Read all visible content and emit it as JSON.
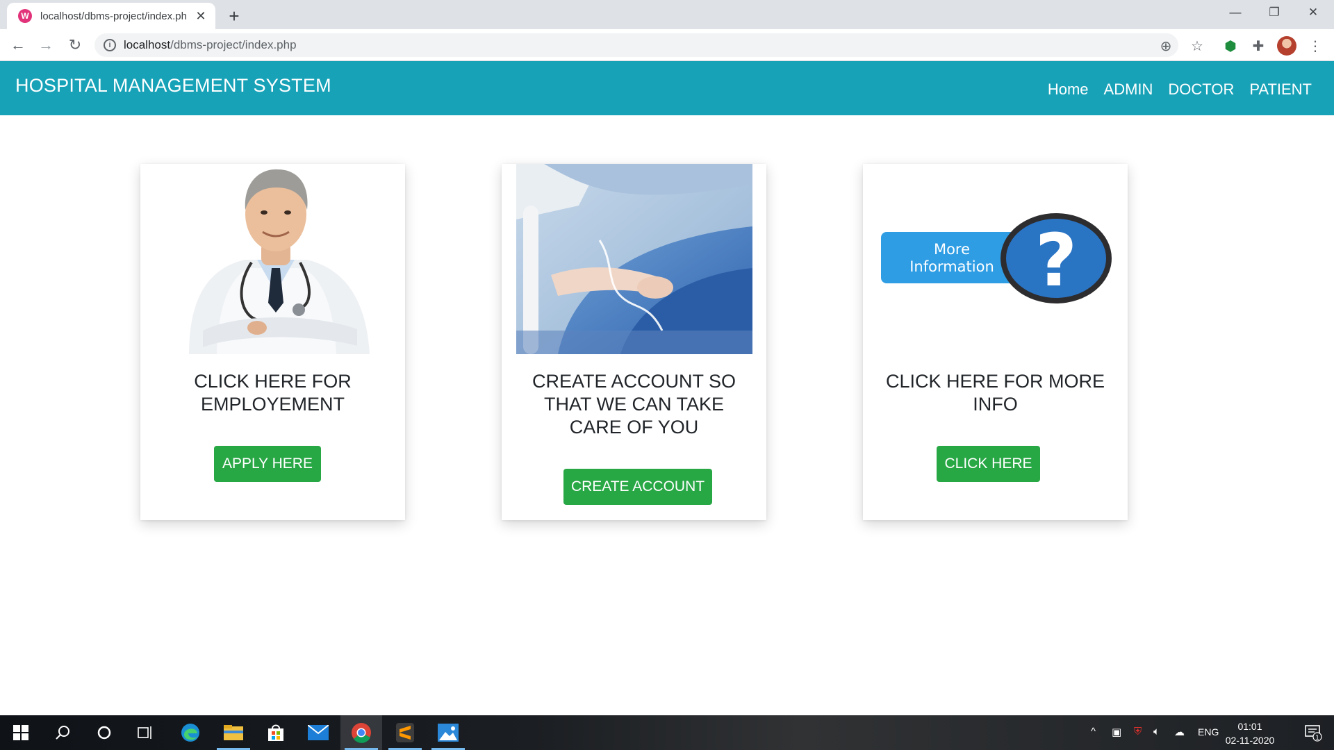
{
  "browser": {
    "tab_title": "localhost/dbms-project/index.ph",
    "favicon_label": "W",
    "url_host": "localhost",
    "url_path": "/dbms-project/index.php"
  },
  "site": {
    "brand": "HOSPITAL MANAGEMENT SYSTEM",
    "nav": [
      "Home",
      "ADMIN",
      "DOCTOR",
      "PATIENT"
    ]
  },
  "cards": [
    {
      "title": "CLICK HERE FOR EMPLOYEMENT",
      "button": "APPLY HERE"
    },
    {
      "title": "CREATE ACCOUNT SO THAT WE CAN TAKE CARE OF YOU",
      "button": "CREATE ACCOUNT"
    },
    {
      "title": "CLICK HERE FOR MORE INFO",
      "button": "CLICK HERE",
      "image_text": [
        "More",
        "Information"
      ],
      "image_symbol": "?"
    }
  ],
  "taskbar": {
    "language": "ENG",
    "time": "01:01",
    "date": "02-11-2020",
    "notifications": "1"
  },
  "colors": {
    "navbar": "#17a2b8",
    "button": "#28a745"
  }
}
